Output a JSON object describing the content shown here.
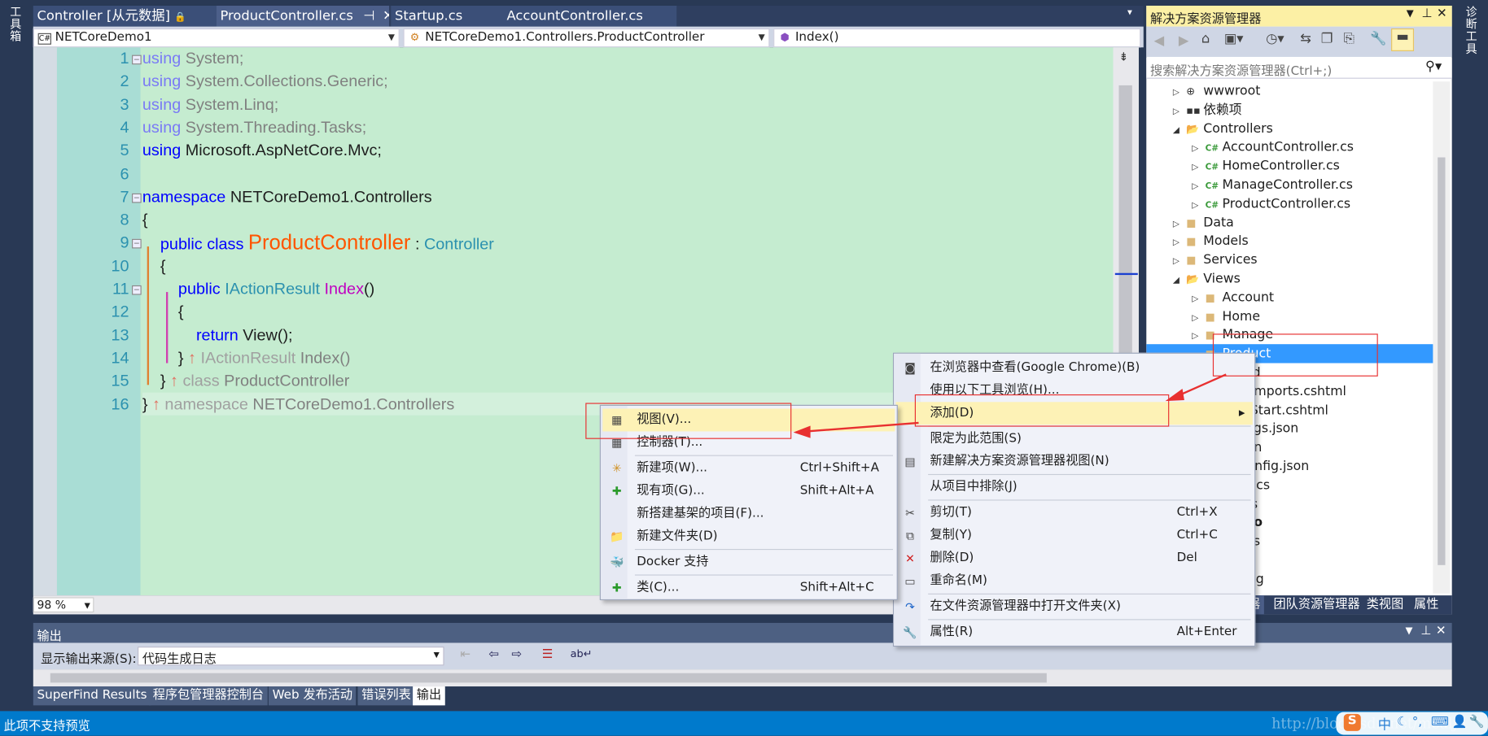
{
  "left_strip": {
    "label": "工具箱"
  },
  "right_strip": {
    "label": "诊断工具"
  },
  "tabs": [
    {
      "label": "Controller [从元数据]",
      "icon": "lock-icon"
    },
    {
      "label": "ProductController.cs",
      "active": true,
      "pin": "⊣",
      "close": "✕"
    },
    {
      "label": "Startup.cs"
    },
    {
      "label": "AccountController.cs"
    }
  ],
  "tab_overflow": "▾",
  "nav": {
    "project": "NETCoreDemo1",
    "class": "NETCoreDemo1.Controllers.ProductController",
    "member": "Index()"
  },
  "zoom_level": "98 %",
  "code": [
    {
      "n": "1",
      "t": [
        [
          "kwg",
          "using"
        ],
        [
          "gr2",
          " System;"
        ]
      ]
    },
    {
      "n": "2",
      "t": [
        [
          "kwg",
          "using"
        ],
        [
          "gr2",
          " System.Collections.Generic;"
        ]
      ]
    },
    {
      "n": "3",
      "t": [
        [
          "kwg",
          "using"
        ],
        [
          "gr2",
          " System.Linq;"
        ]
      ]
    },
    {
      "n": "4",
      "t": [
        [
          "kwg",
          "using"
        ],
        [
          "gr2",
          " System.Threading.Tasks;"
        ]
      ]
    },
    {
      "n": "5",
      "t": [
        [
          "kw",
          "using"
        ],
        [
          "nm",
          " Microsoft.AspNetCore.Mvc;"
        ]
      ]
    },
    {
      "n": "6",
      "t": []
    },
    {
      "n": "7",
      "t": [
        [
          "kw",
          "namespace"
        ],
        [
          "nm",
          " NETCoreDemo1.Controllers"
        ]
      ]
    },
    {
      "n": "8",
      "t": [
        [
          "nm",
          "{"
        ]
      ]
    },
    {
      "n": "9",
      "t": [
        [
          "nm",
          "    "
        ],
        [
          "kw",
          "public class "
        ],
        [
          "cls",
          "ProductController"
        ],
        [
          "nm",
          " : "
        ],
        [
          "ty",
          "Controller"
        ]
      ]
    },
    {
      "n": "10",
      "t": [
        [
          "nm",
          "    {"
        ]
      ]
    },
    {
      "n": "11",
      "t": [
        [
          "nm",
          "        "
        ],
        [
          "kw",
          "public "
        ],
        [
          "ty",
          "IActionResult "
        ],
        [
          "mt",
          "Index"
        ],
        [
          "nm",
          "()"
        ]
      ]
    },
    {
      "n": "12",
      "t": [
        [
          "nm",
          "        {"
        ]
      ]
    },
    {
      "n": "13",
      "t": [
        [
          "nm",
          "            "
        ],
        [
          "kw",
          "return"
        ],
        [
          "nm",
          " View();"
        ]
      ]
    },
    {
      "n": "14",
      "t": [
        [
          "nm",
          "        } "
        ],
        [
          "up",
          "↑ "
        ],
        [
          "gr",
          "IActionResult "
        ],
        [
          "gr2",
          "Index()"
        ]
      ]
    },
    {
      "n": "15",
      "t": [
        [
          "nm",
          "    } "
        ],
        [
          "up",
          "↑ "
        ],
        [
          "gr",
          "class "
        ],
        [
          "gr2",
          "ProductController"
        ]
      ]
    },
    {
      "n": "16",
      "t": [
        [
          "nm",
          "} "
        ],
        [
          "up",
          "↑ "
        ],
        [
          "gr",
          "namespace "
        ],
        [
          "gr2",
          "NETCoreDemo1.Controllers"
        ]
      ]
    }
  ],
  "solution_explorer": {
    "title": "解决方案资源管理器",
    "search_placeholder": "搜索解决方案资源管理器(Ctrl+;)",
    "items": [
      {
        "label": "wwwroot",
        "icon": "globe-icon",
        "level": 0,
        "state": "collapsed"
      },
      {
        "label": "依赖项",
        "icon": "dependencies-icon",
        "level": 0,
        "state": "collapsed"
      },
      {
        "label": "Controllers",
        "icon": "folder-open-icon",
        "level": 0,
        "state": "expanded"
      },
      {
        "label": "AccountController.cs",
        "icon": "csharp-file-icon",
        "level": 1,
        "state": "collapsed"
      },
      {
        "label": "HomeController.cs",
        "icon": "csharp-file-icon",
        "level": 1,
        "state": "collapsed"
      },
      {
        "label": "ManageController.cs",
        "icon": "csharp-file-icon",
        "level": 1,
        "state": "collapsed"
      },
      {
        "label": "ProductController.cs",
        "icon": "csharp-file-icon",
        "level": 1,
        "state": "collapsed"
      },
      {
        "label": "Data",
        "icon": "folder-icon",
        "level": 0,
        "state": "collapsed"
      },
      {
        "label": "Models",
        "icon": "folder-icon",
        "level": 0,
        "state": "collapsed"
      },
      {
        "label": "Services",
        "icon": "folder-icon",
        "level": 0,
        "state": "collapsed"
      },
      {
        "label": "Views",
        "icon": "folder-open-icon",
        "level": 0,
        "state": "expanded"
      },
      {
        "label": "Account",
        "icon": "folder-icon",
        "level": 1,
        "state": "collapsed"
      },
      {
        "label": "Home",
        "icon": "folder-icon",
        "level": 1,
        "state": "collapsed"
      },
      {
        "label": "Manage",
        "icon": "folder-icon",
        "level": 1,
        "state": "collapsed"
      },
      {
        "label": "Product",
        "icon": "folder-icon",
        "level": 1,
        "state": "none",
        "selected": true
      },
      {
        "label": "ared",
        "level": 4,
        "state": "none"
      },
      {
        "label": "ewImports.cshtml",
        "level": 4,
        "state": "none"
      },
      {
        "label": "ewStart.cshtml",
        "level": 4,
        "state": "none"
      },
      {
        "label": "ttings.json",
        "level": 4,
        "state": "none"
      },
      {
        "label": ".json",
        "level": 4,
        "state": "none"
      },
      {
        "label": "econfig.json",
        "level": 4,
        "state": "none"
      },
      {
        "label": "am.cs",
        "level": 4,
        "state": "none"
      },
      {
        "label": "p.cs",
        "level": 4,
        "state": "none"
      },
      {
        "label": "emo",
        "level": 4,
        "state": "none",
        "bold": true
      },
      {
        "label": "rties",
        "level": 4,
        "state": "none"
      },
      {
        "label": "",
        "level": 4,
        "state": "none"
      },
      {
        "label": "onfig",
        "level": 4,
        "state": "none"
      }
    ],
    "bottom_tabs": [
      "器",
      "团队资源管理器",
      "类视图",
      "属性"
    ]
  },
  "context_menu": [
    {
      "label": "在浏览器中查看(Google Chrome)(B)",
      "icon": "browser-view-icon"
    },
    {
      "label": "使用以下工具浏览(H)..."
    },
    {
      "label": "添加(D)",
      "submenu": true,
      "highlighted": true
    },
    {
      "sep": true
    },
    {
      "label": "限定为此范围(S)"
    },
    {
      "label": "新建解决方案资源管理器视图(N)",
      "icon": "new-view-icon"
    },
    {
      "sep": true
    },
    {
      "label": "从项目中排除(J)"
    },
    {
      "sep": true
    },
    {
      "label": "剪切(T)",
      "icon": "scissors-icon",
      "shortcut": "Ctrl+X"
    },
    {
      "label": "复制(Y)",
      "icon": "copy-icon",
      "shortcut": "Ctrl+C"
    },
    {
      "label": "删除(D)",
      "icon": "delete-icon",
      "shortcut": "Del"
    },
    {
      "label": "重命名(M)",
      "icon": "rename-icon"
    },
    {
      "sep": true
    },
    {
      "label": "在文件资源管理器中打开文件夹(X)",
      "icon": "open-folder-arrow-icon"
    },
    {
      "sep": true
    },
    {
      "label": "属性(R)",
      "icon": "wrench-icon",
      "shortcut": "Alt+Enter"
    }
  ],
  "add_submenu": [
    {
      "label": "视图(V)...",
      "icon": "view-file-icon",
      "highlighted": true
    },
    {
      "label": "控制器(T)...",
      "icon": "controller-file-icon"
    },
    {
      "sep": true
    },
    {
      "label": "新建项(W)...",
      "icon": "new-item-icon",
      "shortcut": "Ctrl+Shift+A"
    },
    {
      "label": "现有项(G)...",
      "icon": "existing-item-icon",
      "shortcut": "Shift+Alt+A"
    },
    {
      "label": "新搭建基架的项目(F)..."
    },
    {
      "label": "新建文件夹(D)",
      "icon": "new-folder-icon"
    },
    {
      "sep": true
    },
    {
      "label": "Docker 支持",
      "icon": "docker-icon"
    },
    {
      "sep": true
    },
    {
      "label": "类(C)...",
      "icon": "class-icon",
      "shortcut": "Shift+Alt+C"
    }
  ],
  "output": {
    "title": "输出",
    "source_label": "显示输出来源(S):",
    "source_value": "代码生成日志",
    "tabs": [
      "SuperFind Results",
      "程序包管理器控制台",
      "Web 发布活动",
      "错误列表",
      "输出"
    ],
    "active_tab": "输出"
  },
  "status": {
    "text": "此项不支持预览",
    "watermark": "http://blog.csdn.net/mealjh"
  },
  "ime": {
    "label": "中"
  },
  "colors": {
    "accent": "#007acc",
    "selection": "#3399ff",
    "highlight": "#fdf2b6",
    "annotation": "#e83030",
    "code_bg": "#c5ecd0"
  }
}
